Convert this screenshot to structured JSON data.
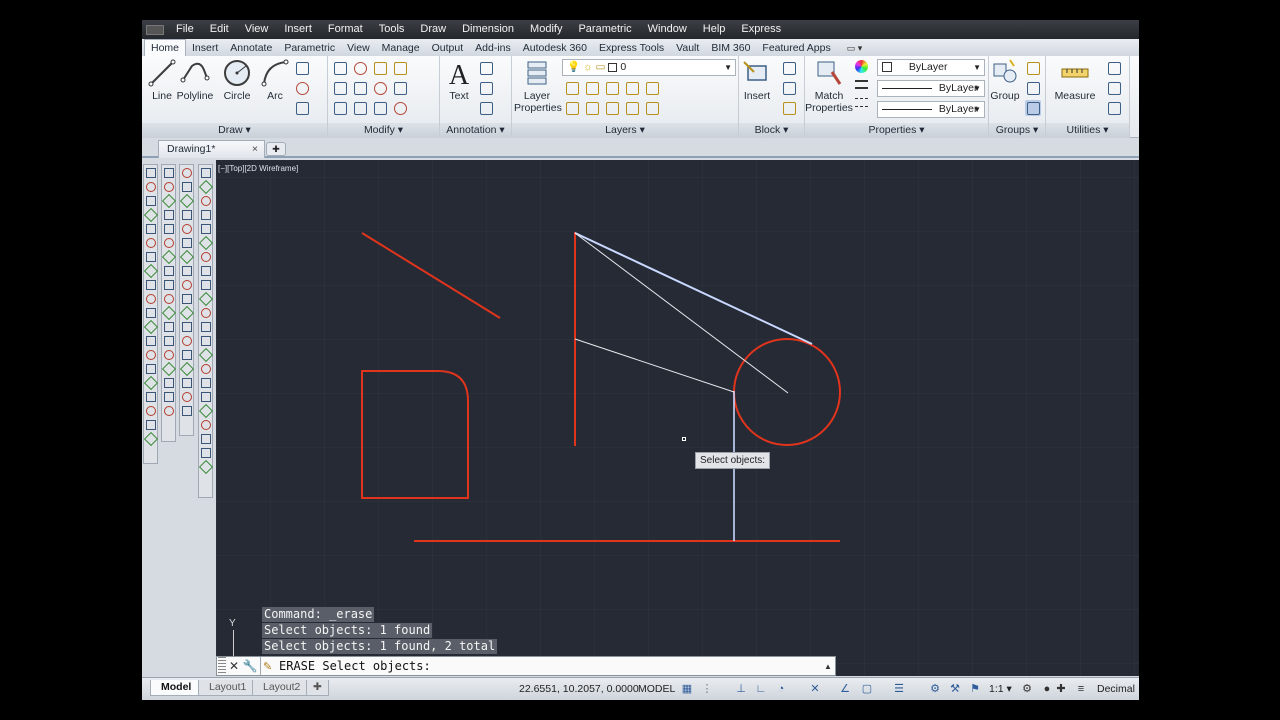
{
  "menu": [
    "File",
    "Edit",
    "View",
    "Insert",
    "Format",
    "Tools",
    "Draw",
    "Dimension",
    "Modify",
    "Parametric",
    "Window",
    "Help",
    "Express"
  ],
  "ribbon_tabs": [
    "Home",
    "Insert",
    "Annotate",
    "Parametric",
    "View",
    "Manage",
    "Output",
    "Add-ins",
    "Autodesk 360",
    "Express Tools",
    "Vault",
    "BIM 360",
    "Featured Apps"
  ],
  "ribbon_toggle": "▭ ▾",
  "draw_panel": {
    "line": "Line",
    "polyline": "Polyline",
    "circle": "Circle",
    "arc": "Arc",
    "title": "Draw ▾"
  },
  "modify_panel": {
    "title": "Modify ▾"
  },
  "annotation_panel": {
    "text": "Text",
    "title": "Annotation ▾"
  },
  "layers_panel": {
    "layer_properties_1": "Layer",
    "layer_properties_2": "Properties",
    "current_layer": "0",
    "title": "Layers ▾"
  },
  "block_panel": {
    "insert": "Insert",
    "title": "Block ▾"
  },
  "properties_panel": {
    "match_1": "Match",
    "match_2": "Properties",
    "color": "ByLayer",
    "linetype": "ByLayer",
    "lineweight": "ByLayer",
    "title": "Properties ▾"
  },
  "groups_panel": {
    "group": "Group",
    "title": "Groups ▾"
  },
  "utilities_panel": {
    "measure": "Measure",
    "title": "Utilities ▾"
  },
  "file_tab": {
    "name": "Drawing1*",
    "close": "×",
    "new": "✚"
  },
  "viewport_label": "[−][Top][2D Wireframe]",
  "ucs_y": "Y",
  "command_history": [
    "Command: _erase",
    "Select objects: 1 found",
    "Select objects: 1 found, 2 total"
  ],
  "tooltip": "Select objects:",
  "command_line": {
    "close": "✕",
    "customize": "🔧",
    "prompt": "ERASE Select objects:",
    "up": "▲"
  },
  "layout_tabs": [
    "Model",
    "Layout1",
    "Layout2"
  ],
  "layout_new": "✚",
  "status": {
    "coords": "22.6551, 10.2057, 0.0000",
    "space": "MODEL",
    "scale": "1:1 ▾",
    "units": "Decimal"
  },
  "colors": {
    "drawing_red": "#e0341c",
    "highlight": "#c9d8ff",
    "canvas": "#252a35"
  }
}
